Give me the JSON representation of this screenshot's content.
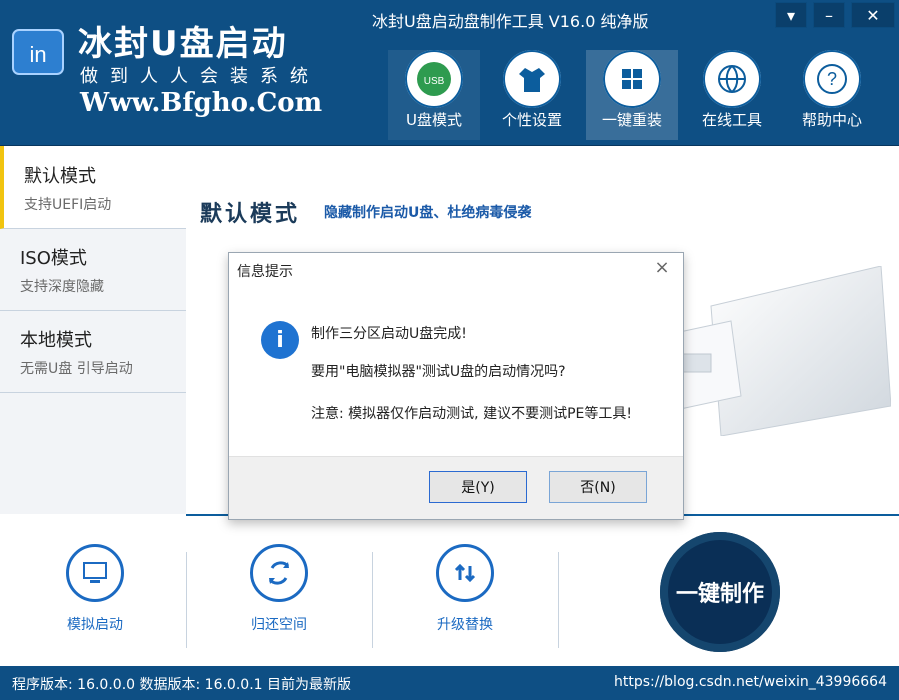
{
  "window": {
    "title": "冰封U盘启动盘制作工具 V16.0 纯净版",
    "controls": {
      "menu_icon": "dropdown-icon",
      "minimize_icon": "minimize-icon",
      "close_icon": "close-icon"
    }
  },
  "brand": {
    "name": "冰封U盘启动",
    "slogan": "做到人人会装系统",
    "url": "Www.Bfgho.Com",
    "logo_text": "in"
  },
  "topnav": [
    {
      "label": "U盘模式",
      "icon": "usb-icon"
    },
    {
      "label": "个性设置",
      "icon": "shirt-icon"
    },
    {
      "label": "一键重装",
      "icon": "windows-icon"
    },
    {
      "label": "在线工具",
      "icon": "globe-icon"
    },
    {
      "label": "帮助中心",
      "icon": "help-icon"
    }
  ],
  "sidebar": {
    "items": [
      {
        "title": "默认模式",
        "subtitle": "支持UEFI启动"
      },
      {
        "title": "ISO模式",
        "subtitle": "支持深度隐藏"
      },
      {
        "title": "本地模式",
        "subtitle": "无需U盘 引导启动"
      }
    ]
  },
  "main": {
    "mode_title": "默认模式",
    "mode_desc": "隐藏制作启动U盘、杜绝病毒侵袭"
  },
  "bottom": {
    "tools": [
      {
        "label": "模拟启动",
        "icon": "monitor-icon"
      },
      {
        "label": "归还空间",
        "icon": "refresh-icon"
      },
      {
        "label": "升级替换",
        "icon": "upgrade-icon"
      }
    ],
    "make_button": "一键制作"
  },
  "status": {
    "left": "程序版本: 16.0.0.0 数据版本: 16.0.0.1 目前为最新版",
    "right": "https://blog.csdn.net/weixin_43996664"
  },
  "dialog": {
    "title": "信息提示",
    "line1": "制作三分区启动U盘完成!",
    "line2": "要用\"电脑模拟器\"测试U盘的启动情况吗?",
    "line3": "注意: 模拟器仅作启动测试, 建议不要测试PE等工具!",
    "yes": "是(Y)",
    "no": "否(N)"
  },
  "colors": {
    "header_blue": "#0e4f84",
    "accent_blue": "#1b6ac2",
    "dialog_icon_blue": "#1f73d1",
    "sidebar_active_border": "#f1c40f"
  }
}
